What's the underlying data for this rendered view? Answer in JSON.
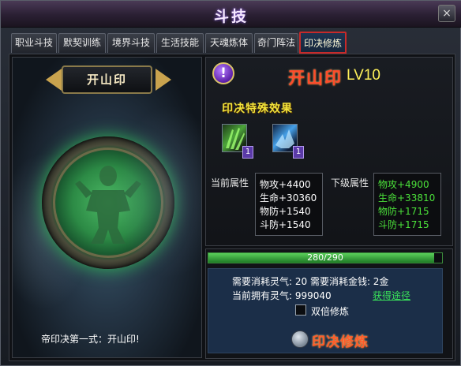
{
  "window": {
    "title": "斗技",
    "close_label": "×"
  },
  "tabs": [
    {
      "label": "职业斗技",
      "active": false
    },
    {
      "label": "默契训练",
      "active": false
    },
    {
      "label": "境界斗技",
      "active": false
    },
    {
      "label": "生活技能",
      "active": false
    },
    {
      "label": "天魂炼体",
      "active": false
    },
    {
      "label": "奇门阵法",
      "active": false
    },
    {
      "label": "印决修炼",
      "active": true
    }
  ],
  "left": {
    "seal_name": "开山印",
    "caption": "帝印决第一式：开山印!"
  },
  "seal": {
    "info_icon": "!",
    "title": "开山印",
    "level": "LV10",
    "effects_heading": "印决特殊效果",
    "skills": [
      {
        "icon": "green-claw-skill-icon",
        "count": "1"
      },
      {
        "icon": "blue-frost-skill-icon",
        "count": "1"
      }
    ]
  },
  "stats": {
    "current_label": "当前属性",
    "next_label": "下级属性",
    "current": [
      "物攻+4400",
      "生命+30360",
      "物防+1540",
      "斗防+1540"
    ],
    "next": [
      "物攻+4900",
      "生命+33810",
      "物防+1715",
      "斗防+1715"
    ]
  },
  "progress": {
    "text": "280/290",
    "value": 280,
    "max": 290
  },
  "cost": {
    "row1": "需要消耗灵气: 20  需要消耗金钱: 2金",
    "row2": "当前拥有灵气: 999040",
    "obtain_link": "获得途径",
    "double_label": "双倍修炼",
    "refine_label": "印决修炼"
  },
  "colors": {
    "active_tab_border": "#c62a2a",
    "next_stat_text": "#4be13a",
    "title_red": "#ff4a2a",
    "level_yellow": "#fff25a"
  }
}
